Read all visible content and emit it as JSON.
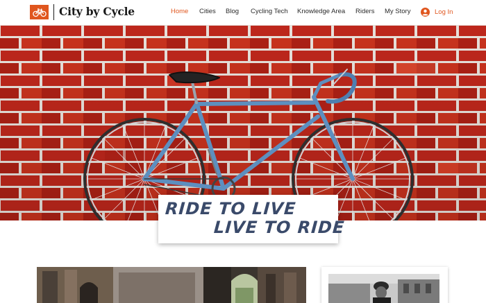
{
  "header": {
    "site_title": "City by Cycle",
    "nav": [
      "Home",
      "Cities",
      "Blog",
      "Cycling Tech",
      "Knowledge Area",
      "Riders",
      "My Story"
    ],
    "active_nav": "Home",
    "login_label": "Log In"
  },
  "hero": {
    "slogan_line_1": "RIDE TO LIVE",
    "slogan_line_2": "LIVE TO RIDE"
  },
  "colors": {
    "accent": "#e0561e",
    "slogan_text": "#3a4a6a",
    "nav_text": "#2b2b2b"
  },
  "icons": {
    "logo": "bicycle-icon",
    "login": "user-avatar-icon"
  }
}
